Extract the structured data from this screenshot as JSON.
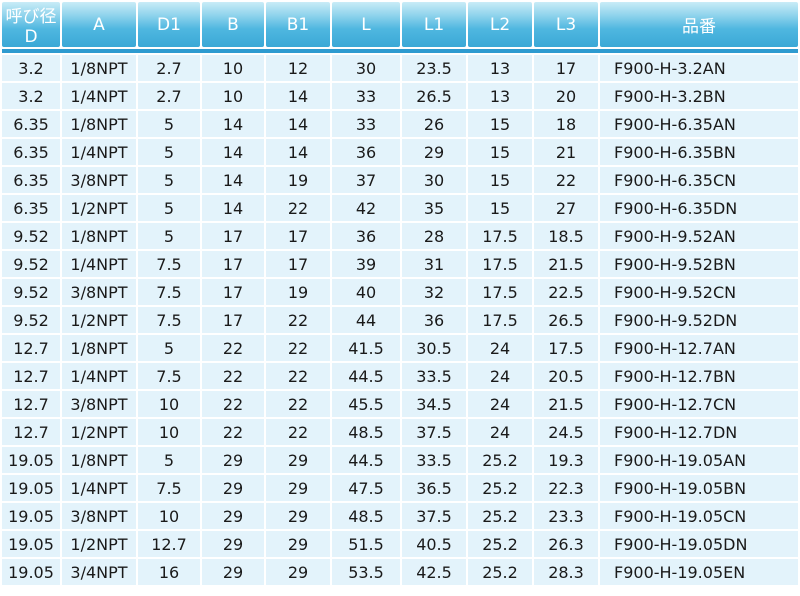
{
  "headers": [
    "呼び径D",
    "A",
    "D1",
    "B",
    "B1",
    "L",
    "L1",
    "L2",
    "L3",
    "品番"
  ],
  "rows": [
    [
      "3.2",
      "1/8NPT",
      "2.7",
      "10",
      "12",
      "30",
      "23.5",
      "13",
      "17",
      "F900-H-3.2AN"
    ],
    [
      "3.2",
      "1/4NPT",
      "2.7",
      "10",
      "14",
      "33",
      "26.5",
      "13",
      "20",
      "F900-H-3.2BN"
    ],
    [
      "6.35",
      "1/8NPT",
      "5",
      "14",
      "14",
      "33",
      "26",
      "15",
      "18",
      "F900-H-6.35AN"
    ],
    [
      "6.35",
      "1/4NPT",
      "5",
      "14",
      "14",
      "36",
      "29",
      "15",
      "21",
      "F900-H-6.35BN"
    ],
    [
      "6.35",
      "3/8NPT",
      "5",
      "14",
      "19",
      "37",
      "30",
      "15",
      "22",
      "F900-H-6.35CN"
    ],
    [
      "6.35",
      "1/2NPT",
      "5",
      "14",
      "22",
      "42",
      "35",
      "15",
      "27",
      "F900-H-6.35DN"
    ],
    [
      "9.52",
      "1/8NPT",
      "5",
      "17",
      "17",
      "36",
      "28",
      "17.5",
      "18.5",
      "F900-H-9.52AN"
    ],
    [
      "9.52",
      "1/4NPT",
      "7.5",
      "17",
      "17",
      "39",
      "31",
      "17.5",
      "21.5",
      "F900-H-9.52BN"
    ],
    [
      "9.52",
      "3/8NPT",
      "7.5",
      "17",
      "19",
      "40",
      "32",
      "17.5",
      "22.5",
      "F900-H-9.52CN"
    ],
    [
      "9.52",
      "1/2NPT",
      "7.5",
      "17",
      "22",
      "44",
      "36",
      "17.5",
      "26.5",
      "F900-H-9.52DN"
    ],
    [
      "12.7",
      "1/8NPT",
      "5",
      "22",
      "22",
      "41.5",
      "30.5",
      "24",
      "17.5",
      "F900-H-12.7AN"
    ],
    [
      "12.7",
      "1/4NPT",
      "7.5",
      "22",
      "22",
      "44.5",
      "33.5",
      "24",
      "20.5",
      "F900-H-12.7BN"
    ],
    [
      "12.7",
      "3/8NPT",
      "10",
      "22",
      "22",
      "45.5",
      "34.5",
      "24",
      "21.5",
      "F900-H-12.7CN"
    ],
    [
      "12.7",
      "1/2NPT",
      "10",
      "22",
      "22",
      "48.5",
      "37.5",
      "24",
      "24.5",
      "F900-H-12.7DN"
    ],
    [
      "19.05",
      "1/8NPT",
      "5",
      "29",
      "29",
      "44.5",
      "33.5",
      "25.2",
      "19.3",
      "F900-H-19.05AN"
    ],
    [
      "19.05",
      "1/4NPT",
      "7.5",
      "29",
      "29",
      "47.5",
      "36.5",
      "25.2",
      "22.3",
      "F900-H-19.05BN"
    ],
    [
      "19.05",
      "3/8NPT",
      "10",
      "29",
      "29",
      "48.5",
      "37.5",
      "25.2",
      "23.3",
      "F900-H-19.05CN"
    ],
    [
      "19.05",
      "1/2NPT",
      "12.7",
      "29",
      "29",
      "51.5",
      "40.5",
      "25.2",
      "26.3",
      "F900-H-19.05DN"
    ],
    [
      "19.05",
      "3/4NPT",
      "16",
      "29",
      "29",
      "53.5",
      "42.5",
      "25.2",
      "28.3",
      "F900-H-19.05EN"
    ]
  ],
  "colors": {
    "header_top": "#c9ecf7",
    "header_bottom": "#3aa8d6",
    "separator": "#2e9bd0",
    "cell_bg": "#e3f3fb",
    "text": "#1a1a1a"
  }
}
